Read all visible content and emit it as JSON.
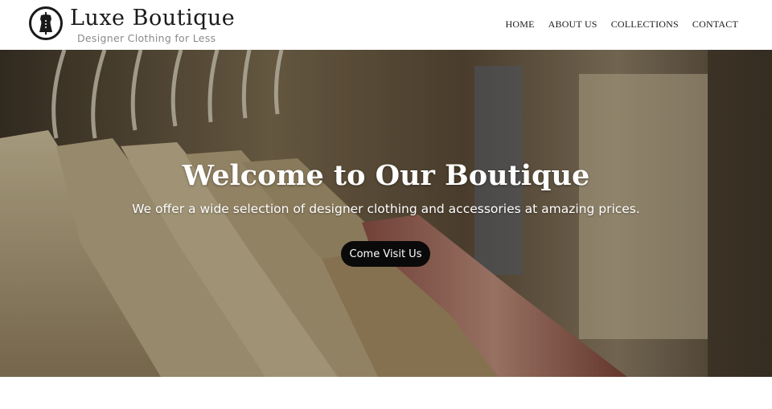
{
  "header": {
    "brand_name": "Luxe Boutique",
    "tagline": "Designer Clothing for Less",
    "logo_icon": "dress-form-icon"
  },
  "nav": {
    "items": [
      {
        "label": "HOME"
      },
      {
        "label": "ABOUT US"
      },
      {
        "label": "COLLECTIONS"
      },
      {
        "label": "CONTACT"
      }
    ]
  },
  "hero": {
    "title": "Welcome to Our Boutique",
    "subtitle": "We offer a wide selection of designer clothing and accessories at amazing prices.",
    "cta_label": "Come Visit Us",
    "background": "clothing-rack-photo"
  },
  "colors": {
    "text_dark": "#1a1a1a",
    "tagline_gray": "#8a8a8a",
    "cta_bg": "#0a0a0a",
    "hero_tone": "#6b5a40"
  }
}
